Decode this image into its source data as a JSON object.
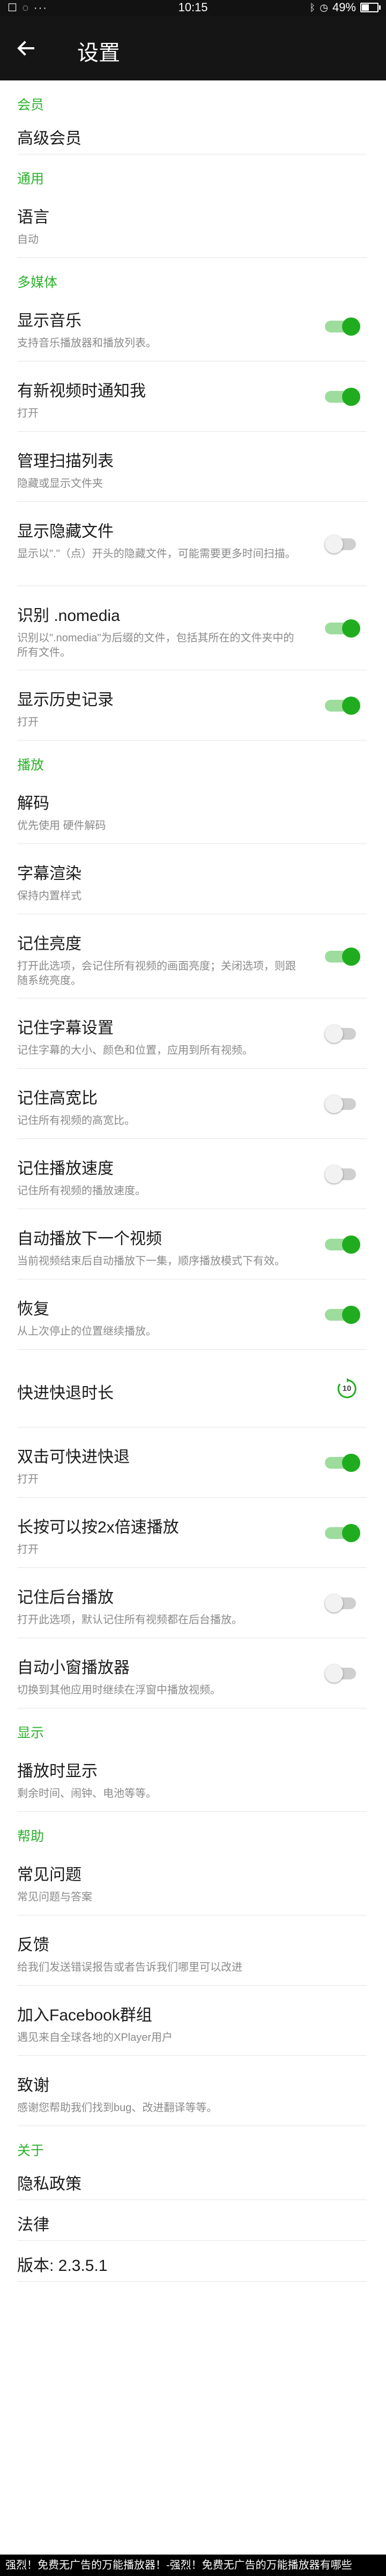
{
  "status_bar": {
    "left_icons": "☐ ◌ ···",
    "time": "10:15",
    "battery_text": "49%",
    "battery_level": 0.49
  },
  "appbar": {
    "title": "设置"
  },
  "sections": [
    {
      "title": "会员",
      "items": [
        {
          "label": "高级会员"
        }
      ]
    },
    {
      "title": "通用",
      "items": [
        {
          "label": "语言",
          "desc": "自动"
        }
      ]
    },
    {
      "title": "多媒体",
      "items": [
        {
          "label": "显示音乐",
          "desc": "支持音乐播放器和播放列表。",
          "toggle": "on"
        },
        {
          "label": "有新视频时通知我",
          "desc": "打开",
          "toggle": "on"
        },
        {
          "label": "管理扫描列表",
          "desc": "隐藏或显示文件夹"
        },
        {
          "label": "显示隐藏文件",
          "desc": "显示以\".\"（点）开头的隐藏文件，可能需要更多时间扫描。",
          "toggle": "off"
        },
        {
          "label": "识别 .nomedia",
          "desc": "识别以\".nomedia\"为后缀的文件，包括其所在的文件夹中的所有文件。",
          "toggle": "on"
        },
        {
          "label": "显示历史记录",
          "desc": "打开",
          "toggle": "on"
        }
      ]
    },
    {
      "title": "播放",
      "items": [
        {
          "label": "解码",
          "desc": "优先使用 硬件解码"
        },
        {
          "label": "字幕渲染",
          "desc": "保持内置样式"
        },
        {
          "label": "记住亮度",
          "desc": "打开此选项，会记住所有视频的画面亮度；关闭选项，则跟随系统亮度。",
          "toggle": "on"
        },
        {
          "label": "记住字幕设置",
          "desc": "记住字幕的大小、颜色和位置，应用到所有视频。",
          "toggle": "off"
        },
        {
          "label": "记住高宽比",
          "desc": "记住所有视频的高宽比。",
          "toggle": "off"
        },
        {
          "label": "记住播放速度",
          "desc": "记住所有视频的播放速度。",
          "toggle": "off"
        },
        {
          "label": "自动播放下一个视频",
          "desc": "当前视频结束后自动播放下一集，顺序播放模式下有效。",
          "toggle": "on"
        },
        {
          "label": "恢复",
          "desc": "从上次停止的位置继续播放。",
          "toggle": "on"
        },
        {
          "label": "快进快退时长",
          "icon": "seek-10-icon",
          "icon_text": "10"
        },
        {
          "label": "双击可快进快退",
          "desc": "打开",
          "toggle": "on"
        },
        {
          "label": "长按可以按2x倍速播放",
          "desc": "打开",
          "toggle": "on"
        },
        {
          "label": "记住后台播放",
          "desc": "打开此选项，默认记住所有视频都在后台播放。",
          "toggle": "off"
        },
        {
          "label": "自动小窗播放器",
          "desc": "切换到其他应用时继续在浮窗中播放视频。",
          "toggle": "off"
        }
      ]
    },
    {
      "title": "显示",
      "items": [
        {
          "label": "播放时显示",
          "desc": "剩余时间、闹钟、电池等等。"
        }
      ]
    },
    {
      "title": "帮助",
      "items": [
        {
          "label": "常见问题",
          "desc": "常见问题与答案"
        },
        {
          "label": "反馈",
          "desc": "给我们发送错误报告或者告诉我们哪里可以改进"
        },
        {
          "label": "加入Facebook群组",
          "desc": "遇见来自全球各地的XPlayer用户"
        },
        {
          "label": "致谢",
          "desc": "感谢您帮助我们找到bug、改进翻译等等。"
        }
      ]
    },
    {
      "title": "关于",
      "items": [
        {
          "label": "隐私政策"
        },
        {
          "label": "法律"
        },
        {
          "label": "版本: 2.3.5.1"
        }
      ]
    }
  ],
  "banner": {
    "text": "强烈！免费无广告的万能播放器！-强烈！免费无广告的万能播放器有哪些"
  },
  "colors": {
    "accent": "#1fad1f",
    "section_title": "#2bb22b",
    "appbar": "#151515"
  }
}
